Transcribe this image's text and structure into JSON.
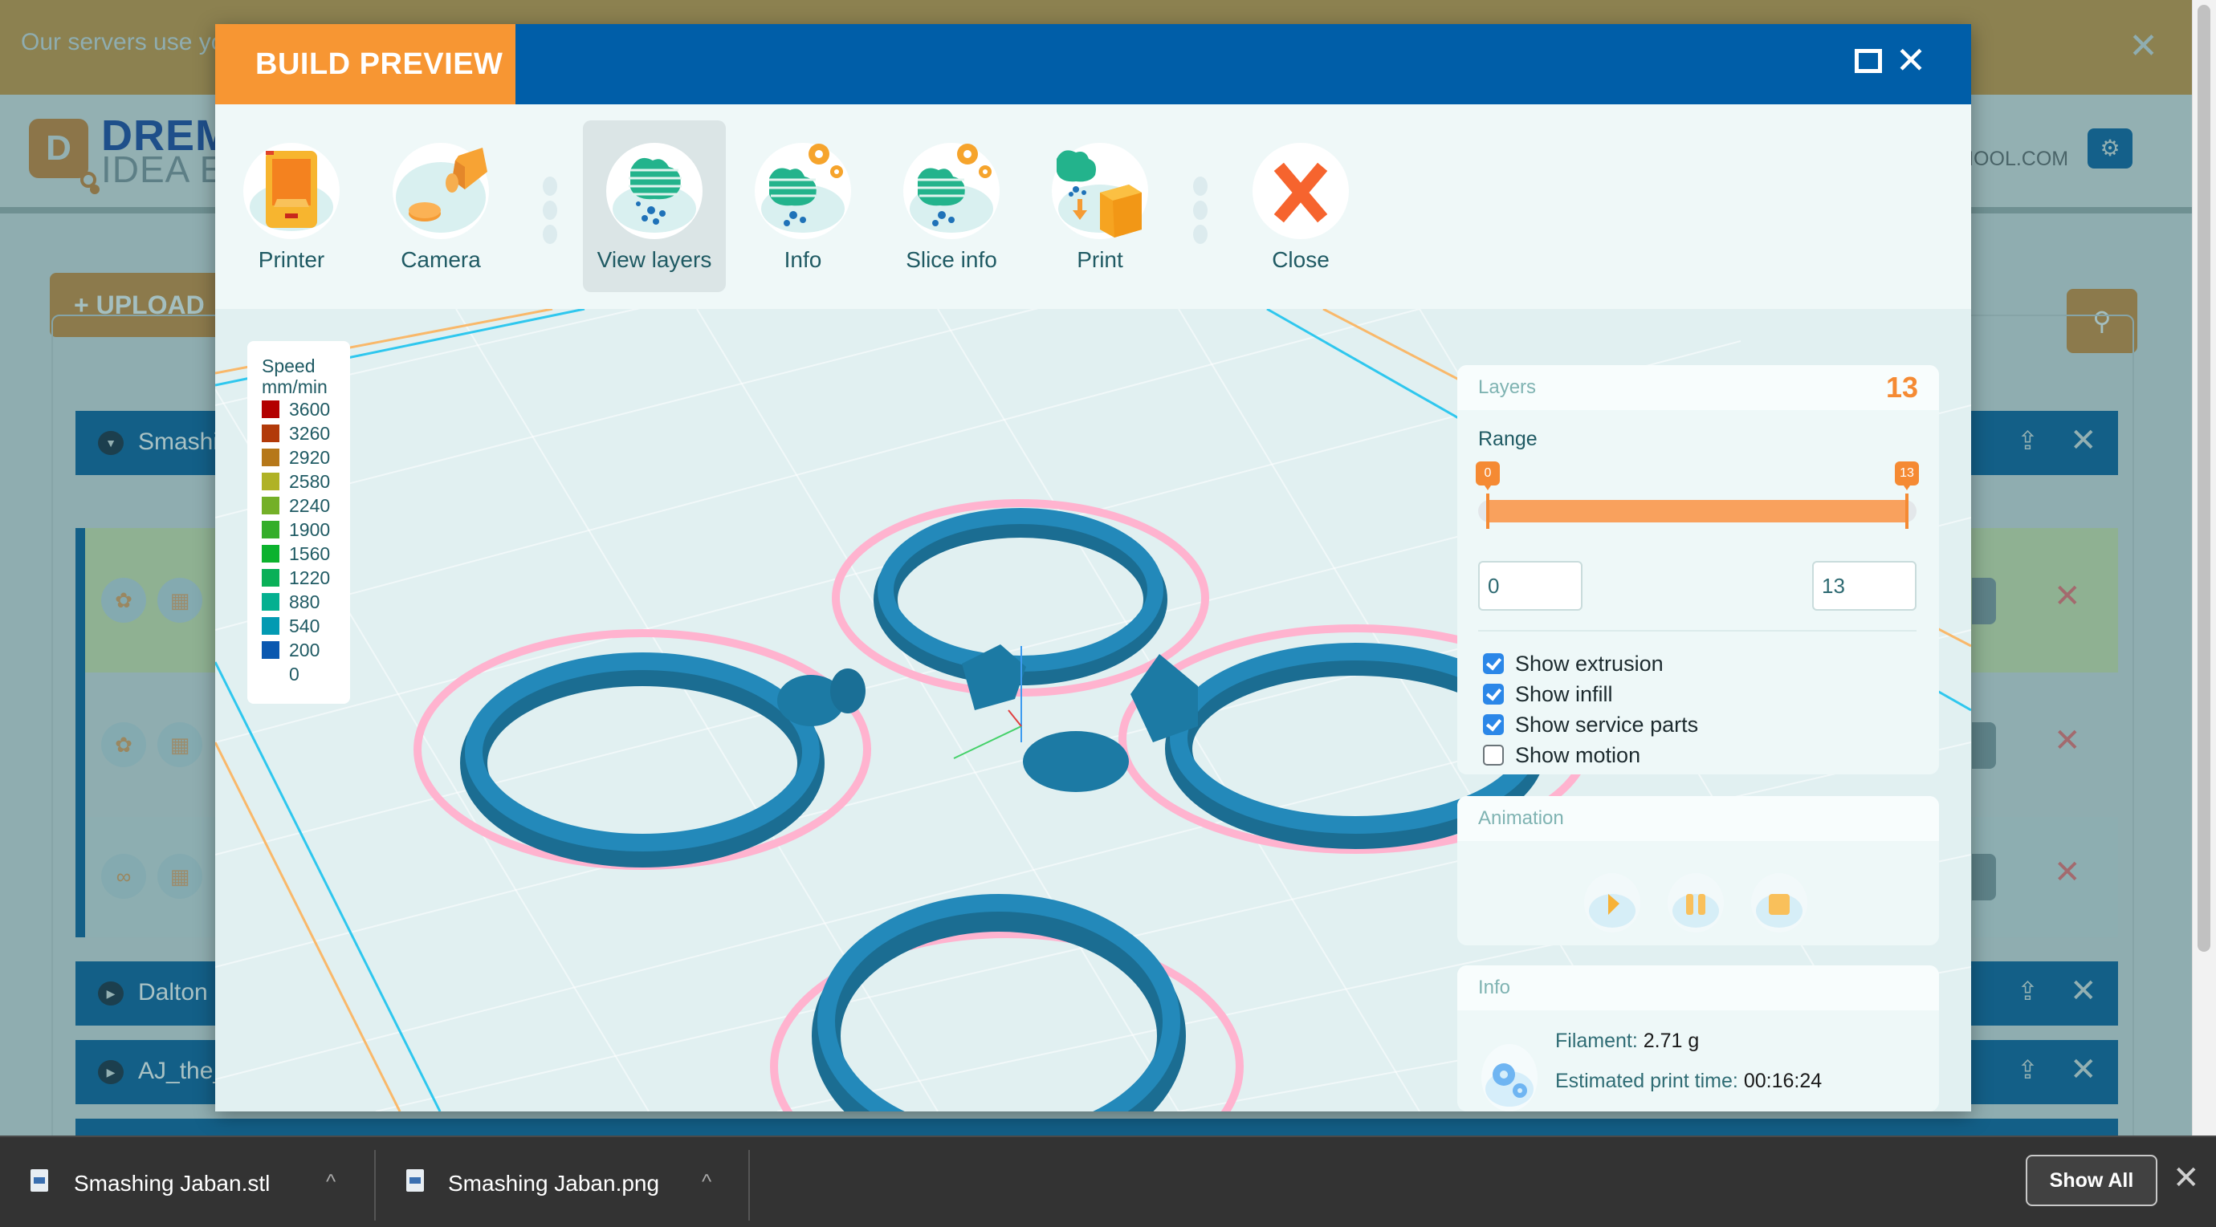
{
  "background": {
    "cookie_banner_text": "Our servers use yo",
    "cookie_close_icon": "✕",
    "logo": {
      "letter": "D",
      "line1": "DREM",
      "line2": "IDEA E"
    },
    "account_email_fragment": "HOOL.COM",
    "settings_icon": "⚙",
    "upload_button": "+ UPLOAD",
    "search_icon": "⚲",
    "groups": [
      {
        "name": "Smashi",
        "expanded": true
      },
      {
        "name": "Dalton",
        "expanded": false
      },
      {
        "name": "AJ_the_",
        "expanded": false
      }
    ],
    "expand_icon": "▼",
    "collapse_icon": "▶",
    "upload_icon": "⇪",
    "delete_icon": "✕",
    "file_rows": [
      {
        "thumb": "✿",
        "preview": "▦",
        "highlighted": true
      },
      {
        "thumb": "✿",
        "preview": "▦",
        "highlighted": false
      },
      {
        "thumb": "∞",
        "preview": "▦",
        "highlighted": false
      }
    ]
  },
  "modal": {
    "title": "BUILD PREVIEW",
    "maximize_icon": "maximize",
    "close_icon": "✕",
    "toolbar": [
      {
        "id": "printer",
        "label": "Printer",
        "active": false
      },
      {
        "id": "camera",
        "label": "Camera",
        "active": false
      },
      {
        "id": "view-layers",
        "label": "View layers",
        "active": true
      },
      {
        "id": "info",
        "label": "Info",
        "active": false
      },
      {
        "id": "slice-info",
        "label": "Slice info",
        "active": false
      },
      {
        "id": "print",
        "label": "Print",
        "active": false
      },
      {
        "id": "close",
        "label": "Close",
        "active": false
      }
    ]
  },
  "speed_legend": {
    "title_line1": "Speed",
    "title_line2": "mm/min",
    "entries": [
      {
        "value": "3600",
        "color": "#b30000"
      },
      {
        "value": "3260",
        "color": "#b23a0a"
      },
      {
        "value": "2920",
        "color": "#b6781a"
      },
      {
        "value": "2580",
        "color": "#b0b226"
      },
      {
        "value": "2240",
        "color": "#74b028"
      },
      {
        "value": "1900",
        "color": "#34ae2a"
      },
      {
        "value": "1560",
        "color": "#0cb22e"
      },
      {
        "value": "1220",
        "color": "#0ab058"
      },
      {
        "value": "880",
        "color": "#04b090"
      },
      {
        "value": "540",
        "color": "#039ab2"
      },
      {
        "value": "200",
        "color": "#0a58b0"
      },
      {
        "value": "0",
        "color": ""
      }
    ]
  },
  "layers_panel": {
    "title": "Layers",
    "layer_count": "13",
    "range_label": "Range",
    "range_min": 0,
    "range_max": 13,
    "range_low": 0,
    "range_high": 13,
    "range_low_text": "0",
    "range_high_text": "13",
    "checkboxes": [
      {
        "label": "Show extrusion",
        "checked": true
      },
      {
        "label": "Show infill",
        "checked": true
      },
      {
        "label": "Show service parts",
        "checked": true
      },
      {
        "label": "Show motion",
        "checked": false
      }
    ]
  },
  "animation_panel": {
    "title": "Animation",
    "buttons": [
      "play",
      "pause",
      "stop"
    ]
  },
  "info_panel": {
    "title": "Info",
    "filament_label": "Filament:",
    "filament_value": "2.71 g",
    "time_label": "Estimated print time:",
    "time_value": "00:16:24"
  },
  "colors": {
    "accent_orange": "#f79633",
    "header_blue": "#005ea8",
    "model_blue": "#1b7fad",
    "service_pink": "#ffb3cf"
  },
  "download_bar": {
    "items": [
      {
        "name": "Smashing Jaban.stl"
      },
      {
        "name": "Smashing Jaban.png"
      }
    ],
    "caret_icon": "^",
    "show_all": "Show All",
    "close_icon": "✕"
  }
}
